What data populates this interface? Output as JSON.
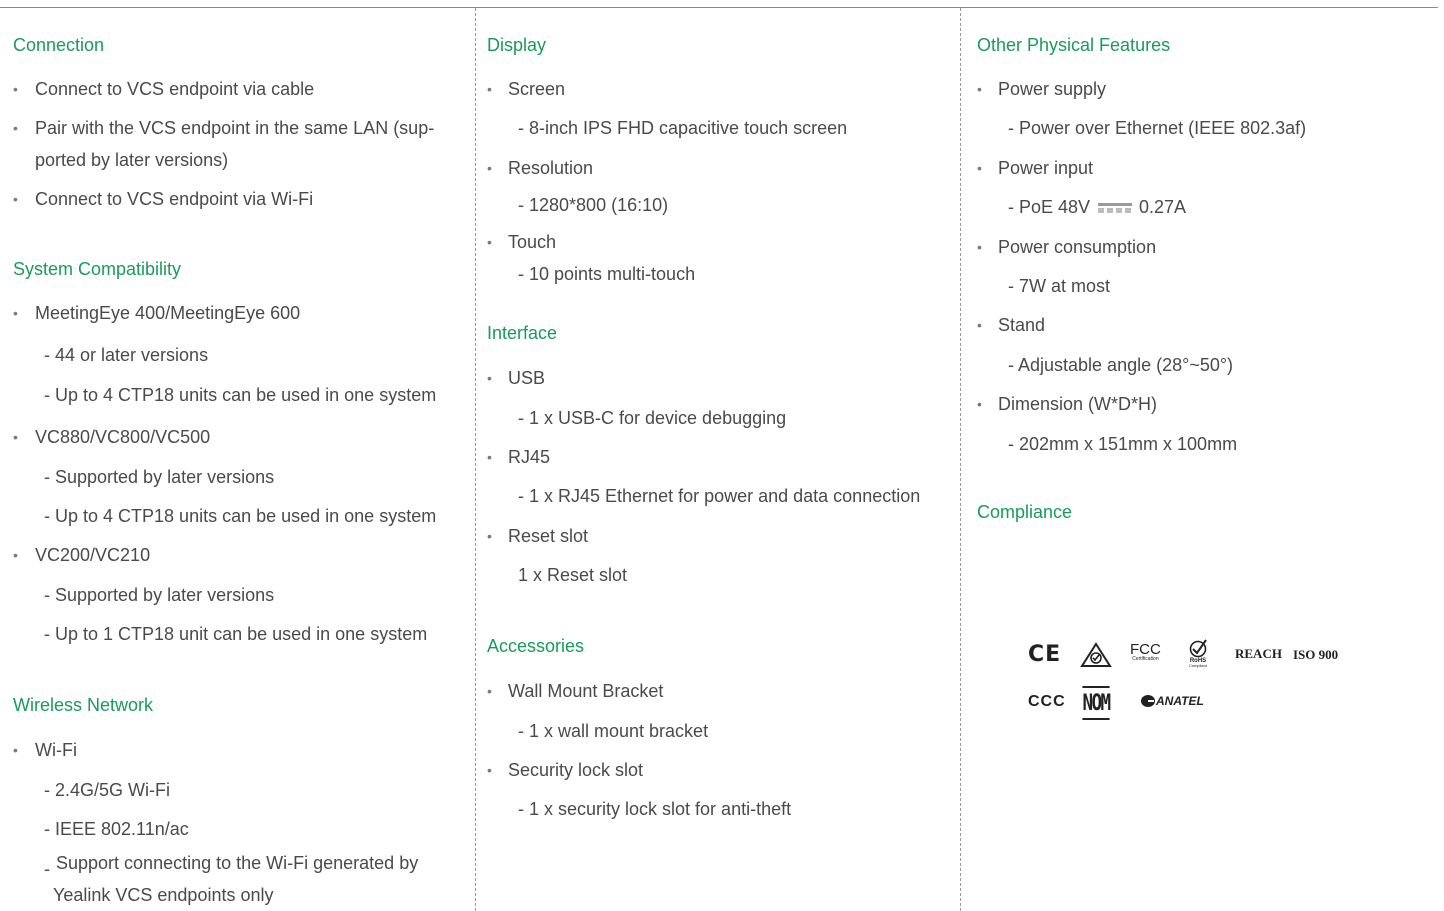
{
  "col1": {
    "connection": {
      "title": "Connection",
      "items": [
        "Connect to VCS endpoint via cable",
        "Pair with the VCS endpoint in the same LAN (sup-",
        "ported by later versions)",
        "Connect to VCS endpoint via Wi-Fi"
      ]
    },
    "compat": {
      "title": "System Compatibility",
      "me": "MeetingEye 400/MeetingEye 600",
      "me_s1": "- 44 or later versions",
      "me_s2": "- Up to 4 CTP18 units can be used in one system",
      "vc": "VC880/VC800/VC500",
      "vc_s1": "- Supported by later versions",
      "vc_s2": "- Up to 4 CTP18 units can be used in one system",
      "vc2": "VC200/VC210",
      "vc2_s1": "- Supported by later versions",
      "vc2_s2": "- Up to 1 CTP18 unit can be used in one system"
    },
    "wireless": {
      "title": "Wireless Network",
      "wifi": "Wi-Fi",
      "s1": "- 2.4G/5G Wi-Fi",
      "s2": "- IEEE 802.11n/ac",
      "s3_dash": "-",
      "s3a": "Support connecting to the Wi-Fi generated by",
      "s3b": "Yealink VCS endpoints only"
    }
  },
  "col2": {
    "display": {
      "title": "Display",
      "screen": "Screen",
      "screen_s": "- 8-inch IPS FHD capacitive touch screen",
      "res": "Resolution",
      "res_s": "- 1280*800 (16:10)",
      "touch": "Touch",
      "touch_s": "- 10 points multi-touch"
    },
    "interface": {
      "title": "Interface",
      "usb": "USB",
      "usb_s": "- 1 x USB-C for device debugging",
      "rj45": "RJ45",
      "rj45_s": "- 1 x RJ45 Ethernet for power and data connection",
      "reset": "Reset slot",
      "reset_s": "1 x Reset slot"
    },
    "accessories": {
      "title": "Accessories",
      "wall": "Wall Mount Bracket",
      "wall_s": "- 1 x wall mount bracket",
      "lock": "Security lock slot",
      "lock_s": "- 1 x security lock slot for anti-theft"
    }
  },
  "col3": {
    "physical": {
      "title": "Other Physical Features",
      "ps": "Power supply",
      "ps_s": "- Power over Ethernet (IEEE 802.3af)",
      "pi": "Power input",
      "pi_s_a": "- PoE 48V",
      "pi_s_b": "0.27A",
      "pc": "Power consumption",
      "pc_s": "- 7W at most",
      "stand": "Stand",
      "stand_s": "- Adjustable angle (28°~50°)",
      "dim": "Dimension (W*D*H)",
      "dim_s": "- 202mm x 151mm x 100mm"
    },
    "compliance": {
      "title": "Compliance",
      "logos": {
        "ce": "CE",
        "fcc": "FCC",
        "fcc_sub": "Certification",
        "rohs": "RoHS",
        "rohs_sub": "Compliant",
        "reach": "REACH",
        "iso": "ISO 900",
        "ccc": "CCC",
        "nom": "NOM",
        "anatel": "ANATEL"
      }
    }
  },
  "colors": {
    "heading": "#1a9b5a",
    "text": "#4a4a4a",
    "divider": "#9a9a9a"
  }
}
